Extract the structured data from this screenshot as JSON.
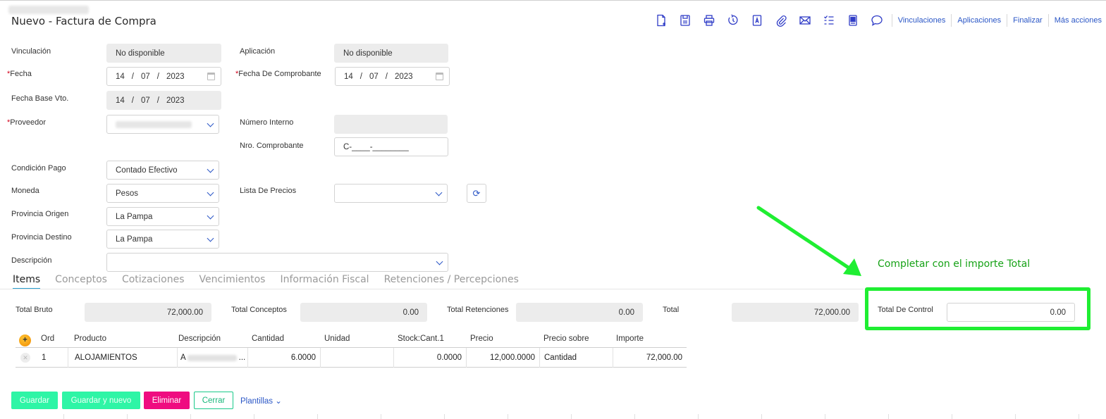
{
  "page": {
    "title": "Nuevo - Factura de Compra"
  },
  "toolbar": {
    "icons": [
      "new-document-icon",
      "save-icon",
      "print-icon",
      "history-icon",
      "pdf-icon",
      "attachment-icon",
      "email-icon",
      "checklist-icon",
      "document-icon",
      "comment-icon"
    ],
    "links": [
      "Vinculaciones",
      "Aplicaciones",
      "Finalizar",
      "Más acciones"
    ]
  },
  "form": {
    "vinculacion": {
      "label": "Vinculación",
      "value": "No disponible"
    },
    "aplicacion": {
      "label": "Aplicación",
      "value": "No disponible"
    },
    "fecha": {
      "label": "Fecha",
      "required": "*",
      "day": "14",
      "month": "07",
      "year": "2023"
    },
    "fecha_comprobante": {
      "label": "Fecha De Comprobante",
      "required": "*",
      "day": "14",
      "month": "07",
      "year": "2023"
    },
    "fecha_base": {
      "label": "Fecha Base Vto.",
      "day": "14",
      "month": "07",
      "year": "2023"
    },
    "proveedor": {
      "label": "Proveedor",
      "required": "*"
    },
    "numero_interno": {
      "label": "Número Interno",
      "value": ""
    },
    "nro_comprobante": {
      "label": "Nro. Comprobante",
      "value": "C-____-________"
    },
    "condicion_pago": {
      "label": "Condición Pago",
      "value": "Contado Efectivo"
    },
    "moneda": {
      "label": "Moneda",
      "value": "Pesos"
    },
    "lista_precios": {
      "label": "Lista De Precios",
      "value": ""
    },
    "provincia_origen": {
      "label": "Provincia Origen",
      "value": "La Pampa"
    },
    "provincia_destino": {
      "label": "Provincia Destino",
      "value": "La Pampa"
    },
    "descripcion": {
      "label": "Descripción",
      "value": ""
    },
    "date_sep": "/"
  },
  "tabs": [
    "Items",
    "Conceptos",
    "Cotizaciones",
    "Vencimientos",
    "Información Fiscal",
    "Retenciones / Percepciones"
  ],
  "totals": {
    "total_bruto": {
      "label": "Total Bruto",
      "value": "72,000.00"
    },
    "total_conceptos": {
      "label": "Total Conceptos",
      "value": "0.00"
    },
    "total_retenciones": {
      "label": "Total Retenciones",
      "value": "0.00"
    },
    "total": {
      "label": "Total",
      "value": "72,000.00"
    },
    "total_control": {
      "label": "Total De Control",
      "value": "0.00"
    }
  },
  "annotation": {
    "text": "Completar con el importe Total",
    "color": "#1fee32"
  },
  "grid": {
    "add_label": "+",
    "remove_label": "✕",
    "columns": [
      "Ord",
      "Producto",
      "Descripción",
      "Cantidad",
      "Unidad",
      "Stock:Cant.1",
      "Precio",
      "Precio sobre",
      "Importe"
    ],
    "rows": [
      {
        "ord": "1",
        "producto": "ALOJAMIENTOS",
        "descripcion_prefix": "A",
        "descripcion_suffix": "...",
        "cantidad": "6.0000",
        "unidad": "",
        "stock": "0.0000",
        "precio": "12,000.0000",
        "precio_sobre": "Cantidad",
        "importe": "72,000.00"
      }
    ]
  },
  "buttons": {
    "guardar": "Guardar",
    "guardar_nuevo": "Guardar y nuevo",
    "eliminar": "Eliminar",
    "cerrar": "Cerrar",
    "plantillas": "Plantillas"
  }
}
